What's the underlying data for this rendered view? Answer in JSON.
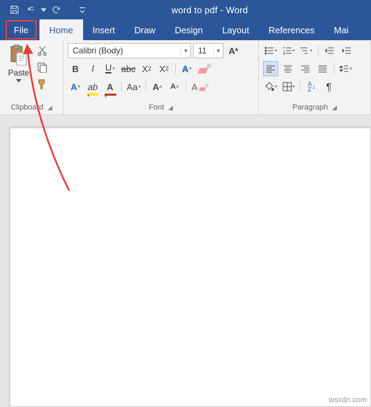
{
  "titlebar": {
    "document_title": "word to pdf  -  Word"
  },
  "tabs": {
    "file": "File",
    "home": "Home",
    "insert": "Insert",
    "draw": "Draw",
    "design": "Design",
    "layout": "Layout",
    "references": "References",
    "mailings": "Mai"
  },
  "clipboard": {
    "paste_label": "Paste",
    "group_label": "Clipboard"
  },
  "font": {
    "group_label": "Font",
    "font_name": "Calibri (Body)",
    "font_size": "11",
    "bold": "B",
    "italic": "I",
    "underline": "U",
    "strike": "abc",
    "sub_base": "X",
    "sub_s": "2",
    "sup_base": "X",
    "sup_s": "2",
    "letter_A": "A",
    "change_case": "Aa",
    "clear_a": "A",
    "hl_mark": "ab"
  },
  "paragraph": {
    "group_label": "Paragraph",
    "sort_a": "A",
    "sort_z": "Z",
    "pilcrow": "¶"
  },
  "watermark": "wsxdn.com"
}
